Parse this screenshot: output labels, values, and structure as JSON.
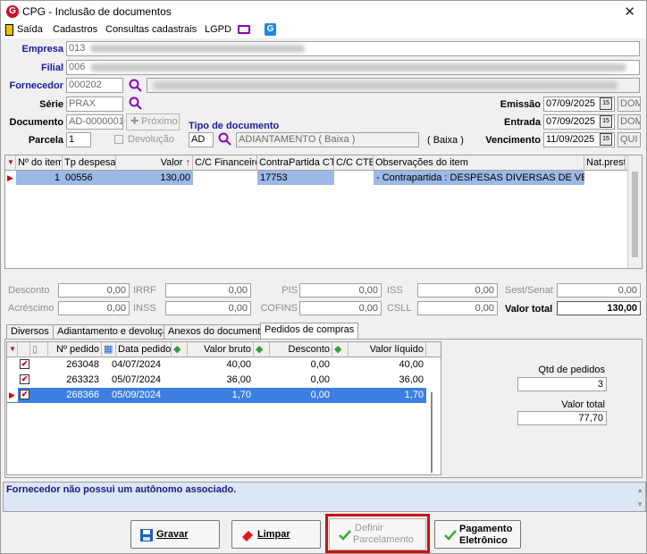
{
  "window": {
    "title": "CPG - Inclusão de documentos",
    "close": "✕"
  },
  "menu": {
    "items": [
      "Saída",
      "Cadastros",
      "Consultas cadastrais",
      "LGPD"
    ]
  },
  "header": {
    "empresa": {
      "label": "Empresa",
      "value": "013"
    },
    "filial": {
      "label": "Filial",
      "value": "006"
    },
    "fornecedor": {
      "label": "Fornecedor",
      "value": "000202"
    },
    "serie": {
      "label": "Série",
      "value": "PRAX"
    },
    "documento": {
      "label": "Documento",
      "value": "AD-0000001",
      "proximo": "Próximo"
    },
    "parcela": {
      "label": "Parcela",
      "value": "1",
      "devolucao": "Devolução"
    },
    "tipo_doc": {
      "label": "Tipo de documento",
      "code": "AD",
      "desc": "ADIANTAMENTO ( Baixa )",
      "tag": "( Baixa )"
    },
    "emissao": {
      "label": "Emissão",
      "date": "07/09/2025",
      "dow": "DOM"
    },
    "entrada": {
      "label": "Entrada",
      "date": "07/09/2025",
      "dow": "DOM"
    },
    "vencimento": {
      "label": "Vencimento",
      "date": "11/09/2025",
      "dow": "QUI"
    }
  },
  "items_grid": {
    "columns": [
      "Nº do item",
      "Tp despesa",
      "Valor",
      "C/C Financeiro",
      "ContraPartida CTB",
      "C/C CTB",
      "Observações do item",
      "Nat.prest."
    ],
    "rows": [
      {
        "item": "1",
        "tp": "00556",
        "valor": "130,00",
        "ccfin": "",
        "contra": "17753",
        "ccctb": "",
        "obs": "- Contrapartida : DESPESAS DIVERSAS DE VEIC…",
        "nat": ""
      }
    ]
  },
  "totals": {
    "desconto": {
      "label": "Desconto",
      "value": "0,00"
    },
    "acrescimo": {
      "label": "Acréscimo",
      "value": "0,00"
    },
    "irrf": {
      "label": "IRRF",
      "value": "0,00"
    },
    "inss": {
      "label": "INSS",
      "value": "0,00"
    },
    "pis": {
      "label": "PIS",
      "value": "0,00"
    },
    "cofins": {
      "label": "COFINS",
      "value": "0,00"
    },
    "iss": {
      "label": "ISS",
      "value": "0,00"
    },
    "csll": {
      "label": "CSLL",
      "value": "0,00"
    },
    "sest": {
      "label": "Sest/Senat",
      "value": "0,00"
    },
    "valor_total": {
      "label": "Valor total",
      "value": "130,00"
    }
  },
  "tabs": [
    "Diversos",
    "Adiantamento e devolução",
    "Anexos do documento",
    "Pedidos de compras"
  ],
  "pedidos": {
    "columns": [
      "Nº pedido",
      "Data pedido",
      "Valor bruto",
      "Desconto",
      "Valor líquido"
    ],
    "rows": [
      {
        "num": "263048",
        "data": "04/07/2024",
        "bruto": "40,00",
        "desc": "0,00",
        "liquido": "40,00",
        "checked": true
      },
      {
        "num": "263323",
        "data": "05/07/2024",
        "bruto": "36,00",
        "desc": "0,00",
        "liquido": "36,00",
        "checked": true
      },
      {
        "num": "268366",
        "data": "05/09/2024",
        "bruto": "1,70",
        "desc": "0,00",
        "liquido": "1,70",
        "checked": true
      }
    ],
    "qtd_label": "Qtd de pedidos",
    "qtd_value": "3",
    "total_label": "Valor total",
    "total_value": "77,70"
  },
  "status": {
    "message": "Fornecedor não possui um autônomo associado."
  },
  "buttons": {
    "gravar": "Gravar",
    "limpar": "Limpar",
    "definir_1": "Definir",
    "definir_2": "Parcelamento",
    "pagamento_1": "Pagamento",
    "pagamento_2": "Eletrônico"
  },
  "colors": {
    "accent_red": "#c8102e",
    "label_blue": "#1a1aa0",
    "selection": "#9cb8e6",
    "status_bg": "#dce6f5",
    "highlight": "#cc1111"
  }
}
